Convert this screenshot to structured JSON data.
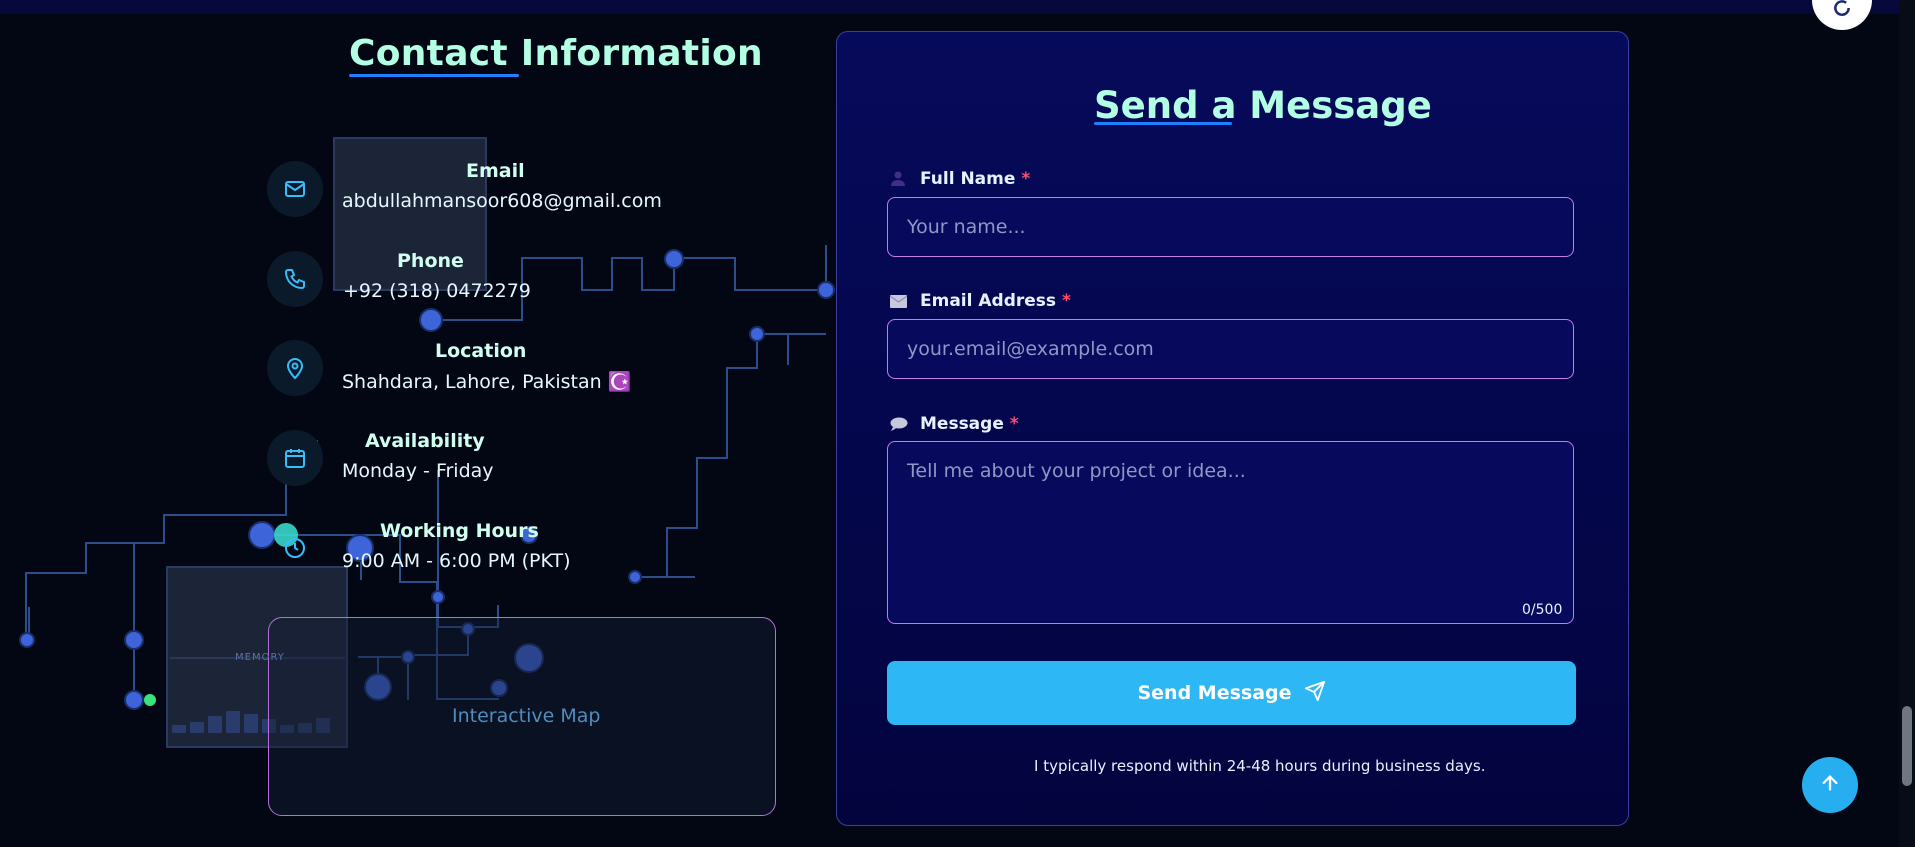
{
  "contact": {
    "title": "Contact Information",
    "items": [
      {
        "label": "Email",
        "value": "abdullahmansoor608@gmail.com",
        "icon": "mail-icon"
      },
      {
        "label": "Phone",
        "value": "+92 (318) 0472279",
        "icon": "phone-icon"
      },
      {
        "label": "Location",
        "value": "Shahdara, Lahore, Pakistan ☪️",
        "icon": "map-pin-icon"
      },
      {
        "label": "Availability",
        "value": "Monday - Friday",
        "icon": "calendar-icon"
      },
      {
        "label": "Working Hours",
        "value": "9:00 AM - 6:00 PM (PKT)",
        "icon": "clock-icon"
      }
    ],
    "map_label": "Interactive Map",
    "memory_label": "MEMORY"
  },
  "form": {
    "title": "Send a Message",
    "required_mark": "*",
    "name": {
      "label": "Full Name",
      "placeholder": "Your name...",
      "value": ""
    },
    "email": {
      "label": "Email Address",
      "placeholder": "your.email@example.com",
      "value": ""
    },
    "message": {
      "label": "Message",
      "placeholder": "Tell me about your project or idea...",
      "value": "",
      "counter": "0/500"
    },
    "submit_label": "Send Message",
    "note": "I typically respond within 24-48 hours during business days."
  },
  "colors": {
    "background": "#030714",
    "accent": "#2db8f5",
    "heading": "#b3ffe3",
    "card": "#060a5a",
    "input_border": "#c47de0",
    "required": "#ff4d6d"
  }
}
